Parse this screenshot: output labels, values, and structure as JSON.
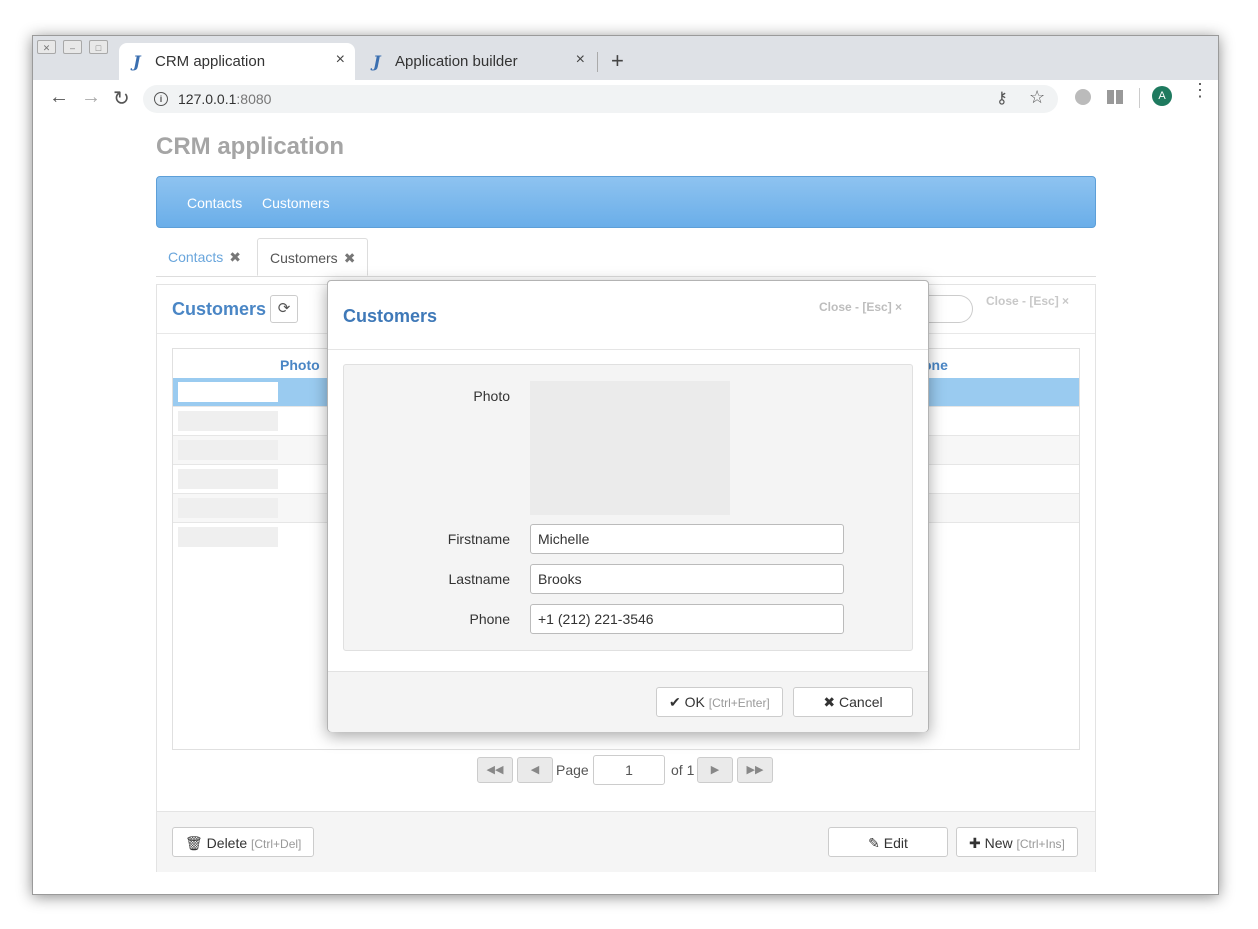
{
  "browser": {
    "tabs": [
      {
        "icon": "J",
        "title": "CRM application",
        "active": true
      },
      {
        "icon": "J",
        "title": "Application builder",
        "active": false
      }
    ],
    "new_tab": "+",
    "url_host": "127.0.0.1",
    "url_port": ":8080",
    "profile_initial": "A"
  },
  "app": {
    "title": "CRM application",
    "nav": [
      "Contacts",
      "Customers"
    ],
    "tabs": [
      {
        "label": "Contacts",
        "close": "✖"
      },
      {
        "label": "Customers",
        "close": "✖"
      }
    ]
  },
  "panel": {
    "title": "Customers",
    "close_text": "Close - [Esc] ×",
    "columns": [
      "Photo",
      "one"
    ],
    "rows": 6,
    "pager": {
      "page_label": "Page",
      "page_value": "1",
      "of_label": "of 1"
    },
    "footer": {
      "delete_label": "Delete",
      "delete_hint": "[Ctrl+Del]",
      "edit_label": "Edit",
      "new_label": "New",
      "new_hint": "[Ctrl+Ins]"
    }
  },
  "modal": {
    "title": "Customers",
    "close_text": "Close - [Esc] ×",
    "fields": {
      "photo_label": "Photo",
      "firstname_label": "Firstname",
      "firstname_value": "Michelle",
      "lastname_label": "Lastname",
      "lastname_value": "Brooks",
      "phone_label": "Phone",
      "phone_value": "+1 (212) 221-3546"
    },
    "ok_label": "OK",
    "ok_hint": "[Ctrl+Enter]",
    "cancel_label": "Cancel"
  },
  "colors": {
    "accent": "#4a86c5",
    "navbar": "#7ab8ee",
    "selected_row": "#9acbf0"
  }
}
